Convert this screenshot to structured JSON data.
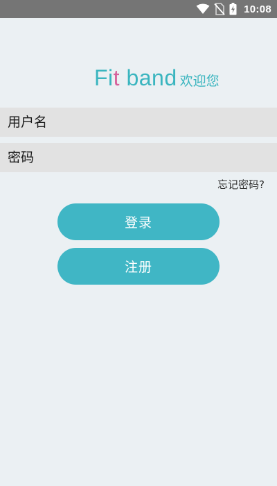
{
  "status_bar": {
    "time": "10:08",
    "icons": [
      "wifi-icon",
      "no-sim-icon",
      "battery-charging-icon"
    ]
  },
  "logo": {
    "brand_part1": "Fi",
    "brand_accent": "t",
    "brand_part2": " band",
    "welcome": "欢迎您"
  },
  "form": {
    "username_placeholder": "用户名",
    "password_placeholder": "密码",
    "forgot_label": "忘记密码?"
  },
  "buttons": {
    "login_label": "登录",
    "register_label": "注册"
  },
  "colors": {
    "accent": "#40b6c5",
    "brand_pink": "#d6609b",
    "background": "#ebf0f3",
    "field": "#e2e2e2",
    "status_bar": "#757575"
  }
}
